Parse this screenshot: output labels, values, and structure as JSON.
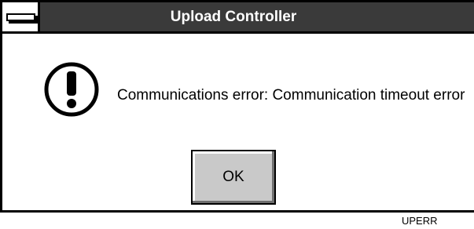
{
  "dialog": {
    "title": "Upload Controller",
    "message": "Communications error:  Communication timeout error",
    "ok_label": "OK",
    "icon": "exclamation-icon"
  },
  "caption": "UPERR",
  "colors": {
    "titlebar": "#3a3a3a",
    "button_face": "#c9c9c9",
    "border": "#000000"
  }
}
